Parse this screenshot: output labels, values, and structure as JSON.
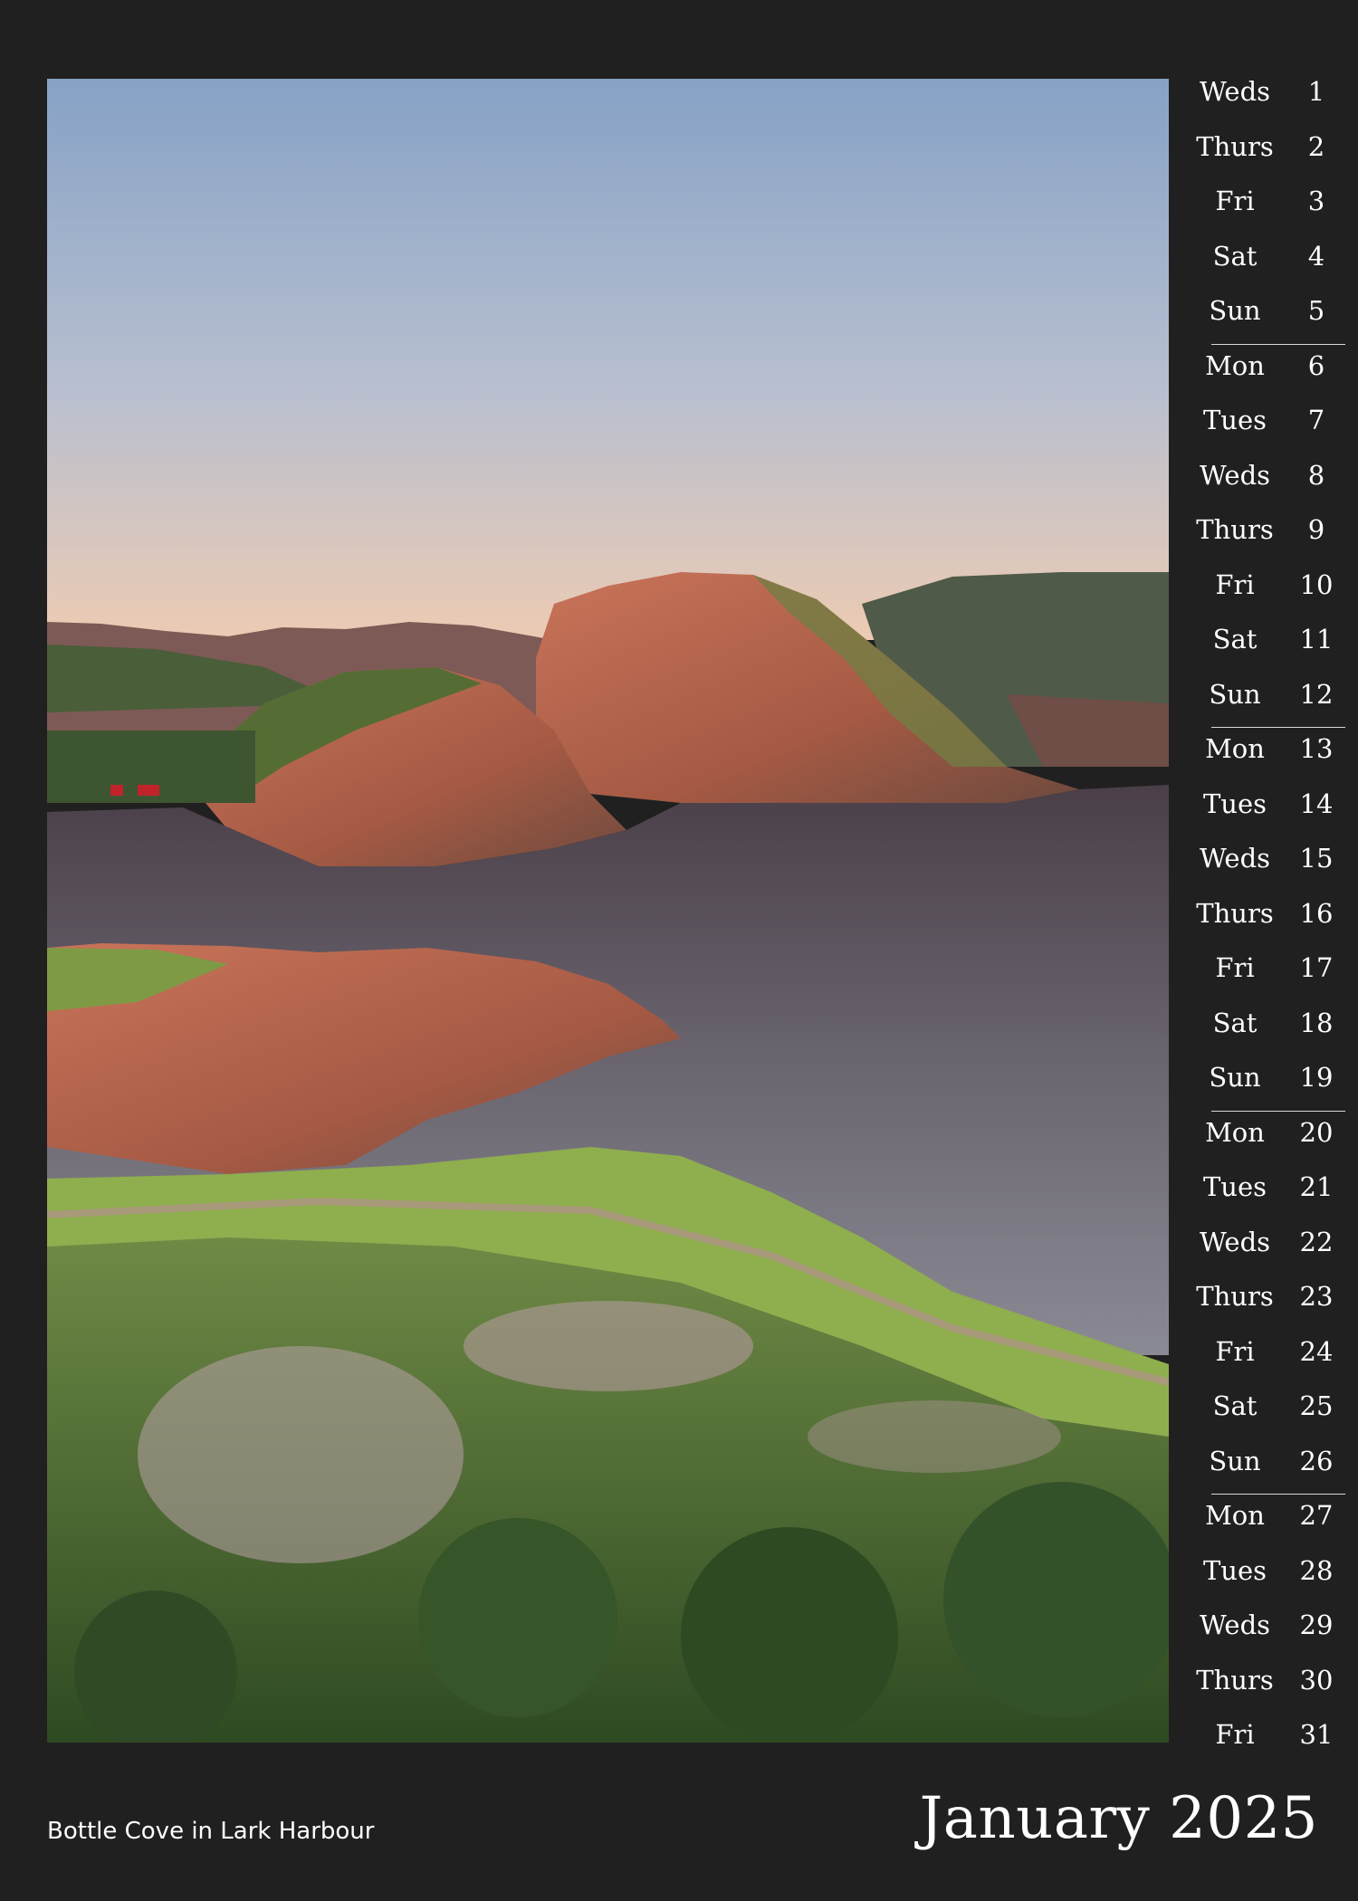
{
  "photo": {
    "caption": "Bottle Cove in Lark Harbour",
    "colors": {
      "sky_top": "#8aa4c6",
      "sky_bottom": "#e8cbb6",
      "rock": "#b8634a",
      "water": "#5b5660",
      "grass": "#8fae4e",
      "forest": "#3c5a2a"
    }
  },
  "calendar": {
    "month": "January 2025",
    "days": [
      {
        "name": "Weds",
        "num": "1"
      },
      {
        "name": "Thurs",
        "num": "2"
      },
      {
        "name": "Fri",
        "num": "3"
      },
      {
        "name": "Sat",
        "num": "4"
      },
      {
        "name": "Sun",
        "num": "5"
      },
      {
        "name": "Mon",
        "num": "6"
      },
      {
        "name": "Tues",
        "num": "7"
      },
      {
        "name": "Weds",
        "num": "8"
      },
      {
        "name": "Thurs",
        "num": "9"
      },
      {
        "name": "Fri",
        "num": "10"
      },
      {
        "name": "Sat",
        "num": "11"
      },
      {
        "name": "Sun",
        "num": "12"
      },
      {
        "name": "Mon",
        "num": "13"
      },
      {
        "name": "Tues",
        "num": "14"
      },
      {
        "name": "Weds",
        "num": "15"
      },
      {
        "name": "Thurs",
        "num": "16"
      },
      {
        "name": "Fri",
        "num": "17"
      },
      {
        "name": "Sat",
        "num": "18"
      },
      {
        "name": "Sun",
        "num": "19"
      },
      {
        "name": "Mon",
        "num": "20"
      },
      {
        "name": "Tues",
        "num": "21"
      },
      {
        "name": "Weds",
        "num": "22"
      },
      {
        "name": "Thurs",
        "num": "23"
      },
      {
        "name": "Fri",
        "num": "24"
      },
      {
        "name": "Sat",
        "num": "25"
      },
      {
        "name": "Sun",
        "num": "26"
      },
      {
        "name": "Mon",
        "num": "27"
      },
      {
        "name": "Tues",
        "num": "28"
      },
      {
        "name": "Weds",
        "num": "29"
      },
      {
        "name": "Thurs",
        "num": "30"
      },
      {
        "name": "Fri",
        "num": "31"
      }
    ]
  }
}
